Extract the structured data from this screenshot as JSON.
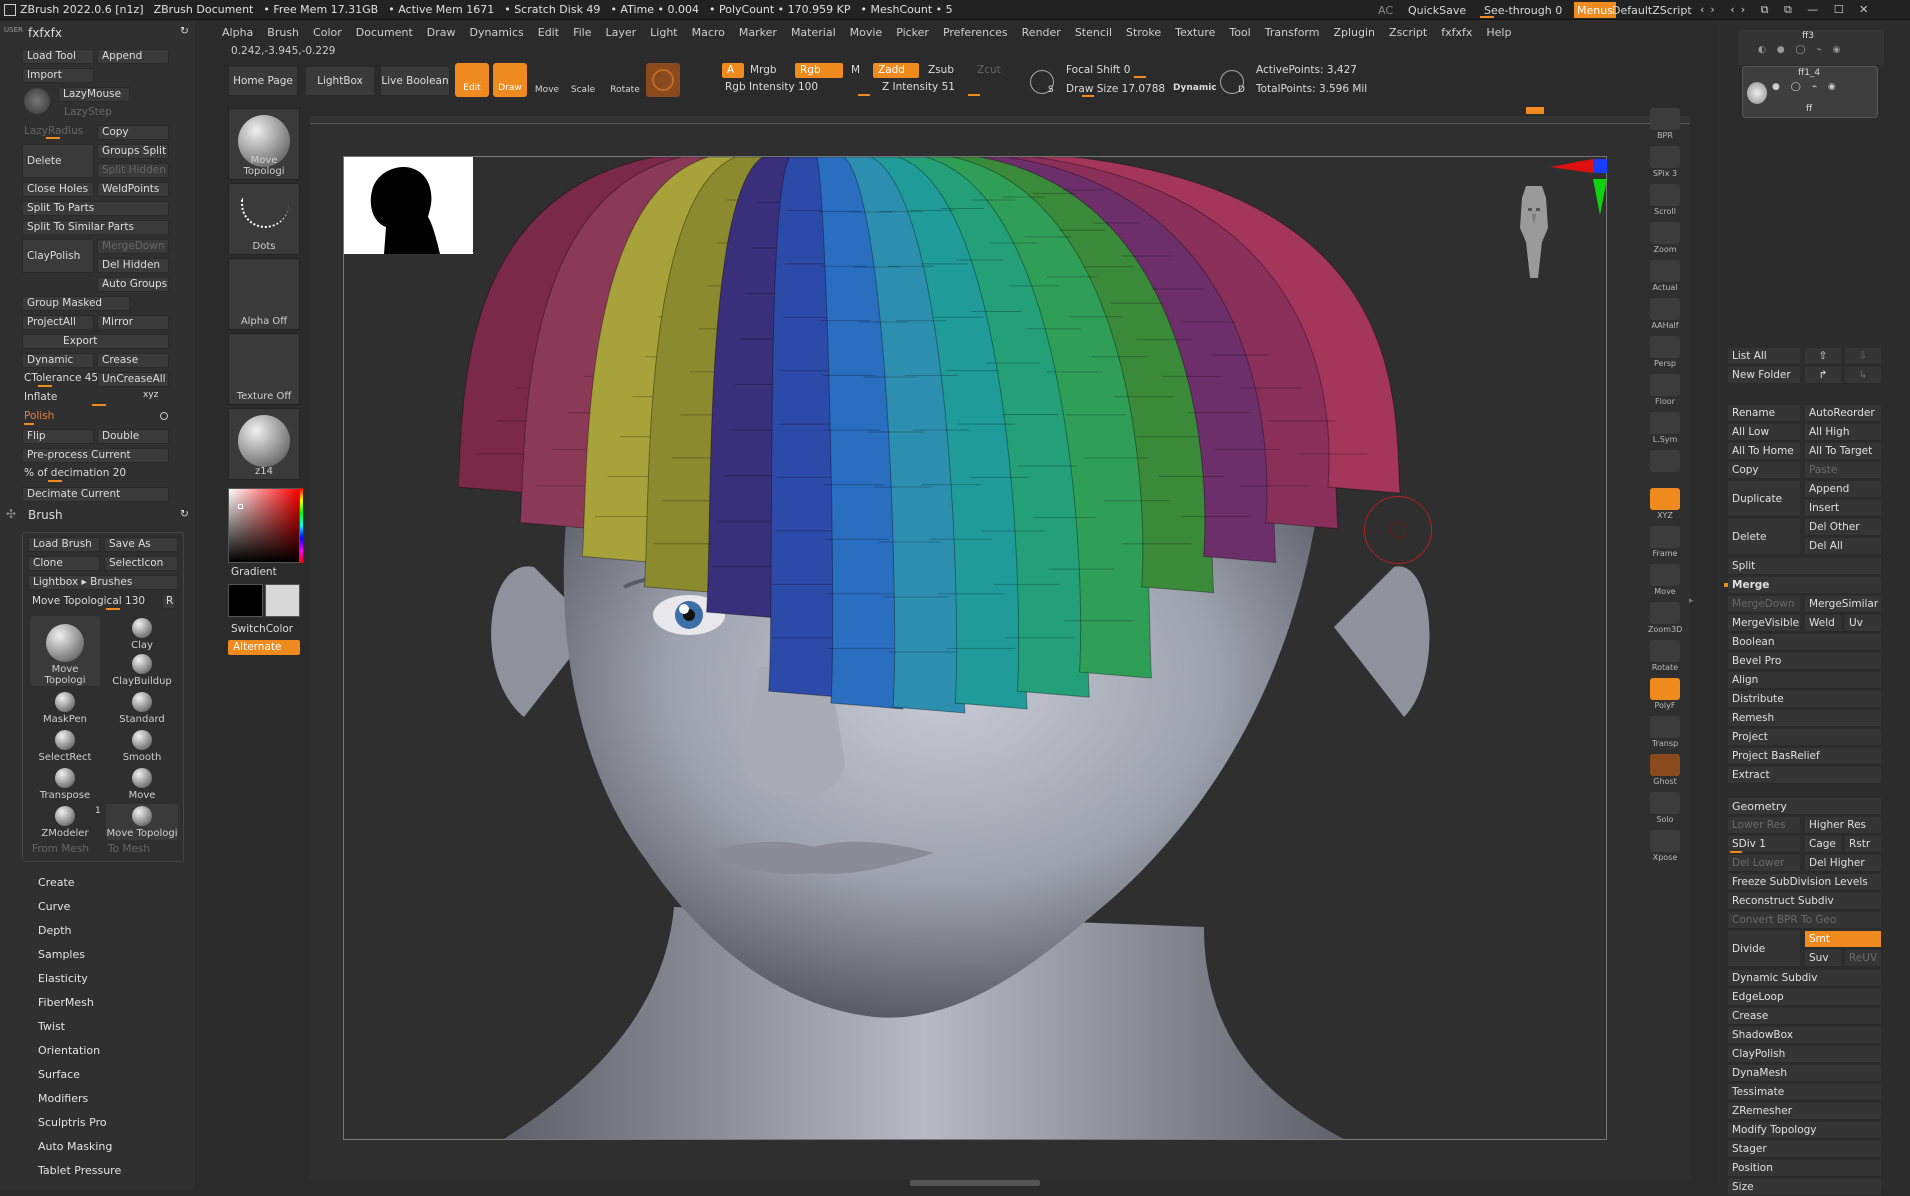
{
  "title_bar": {
    "app": "ZBrush 2022.0.6 [n1z]",
    "doc": "ZBrush Document",
    "free_mem": "• Free Mem 17.31GB",
    "active_mem": "• Active Mem 1671",
    "scratch": "• Scratch Disk 49",
    "atime": "• ATime • 0.004",
    "polycount": "• PolyCount • 170.959 KP",
    "meshcount": "• MeshCount • 5",
    "ac": "AC",
    "quicksave": "QuickSave",
    "see_through": "See-through  0",
    "menus": "Menus",
    "default_script": "DefaultZScript"
  },
  "menus": [
    "Alpha",
    "Brush",
    "Color",
    "Document",
    "Draw",
    "Dynamics",
    "Edit",
    "File",
    "Layer",
    "Light",
    "Macro",
    "Marker",
    "Material",
    "Movie",
    "Picker",
    "Preferences",
    "Render",
    "Stencil",
    "Stroke",
    "Texture",
    "Tool",
    "Transform",
    "Zplugin",
    "Zscript",
    "fxfxfx",
    "Help"
  ],
  "left_panel": {
    "user": "USER",
    "tool_name": "fxfxfx",
    "buttons": {
      "load_tool": "Load Tool",
      "append": "Append",
      "import": "Import",
      "lazymouse": "LazyMouse",
      "lazystep": "LazyStep",
      "lazyradius": "LazyRadius",
      "copy": "Copy",
      "delete": "Delete",
      "groups_split": "Groups Split",
      "split_hidden": "Split Hidden",
      "close_holes": "Close Holes",
      "weldpoints": "WeldPoints",
      "split_to_parts": "Split To Parts",
      "split_similar": "Split To Similar Parts",
      "claypolish": "ClayPolish",
      "mergedown": "MergeDown",
      "del_hidden": "Del Hidden",
      "auto_groups": "Auto Groups",
      "group_masked": "Group Masked",
      "projectall": "ProjectAll",
      "mirror": "Mirror",
      "export": "Export",
      "dynamic": "Dynamic",
      "crease": "Crease",
      "ctolerance": "CTolerance 45",
      "uncreaseall": "UnCreaseAll",
      "inflate": "Inflate",
      "xyz": "xyz",
      "polish": "Polish",
      "flip": "Flip",
      "double": "Double",
      "preprocess": "Pre-process Current",
      "decimation": "% of decimation 20",
      "decimate": "Decimate Current"
    }
  },
  "brush_panel": {
    "title": "Brush",
    "load_brush": "Load Brush",
    "save_as": "Save As",
    "clone": "Clone",
    "selecticon": "SelectIcon",
    "lightbox_brushes": "Lightbox ▸ Brushes",
    "move_topo_slider": "Move Topological  130",
    "r": "R",
    "brushes": [
      "Move Topologi",
      "Clay",
      "ClayBuildup",
      "MaskPen",
      "Standard",
      "SelectRect",
      "Smooth",
      "Transpose",
      "Move",
      "ZModeler",
      "Move Topologi"
    ],
    "zmodeler_count": "1",
    "from_mesh": "From Mesh",
    "to_mesh": "To Mesh"
  },
  "brush_sections": [
    "Create",
    "Curve",
    "Depth",
    "Samples",
    "Elasticity",
    "FiberMesh",
    "Twist",
    "Orientation",
    "Surface",
    "Modifiers",
    "Sculptris Pro",
    "Auto Masking",
    "Tablet Pressure"
  ],
  "shelf": {
    "coords": "0.242,-3.945,-0.229",
    "home_page": "Home Page",
    "lightbox": "LightBox",
    "live_boolean": "Live Boolean",
    "edit": "Edit",
    "draw": "Draw",
    "move": "Move",
    "scale": "Scale",
    "rotate": "Rotate",
    "a": "A",
    "mrgb": "Mrgb",
    "rgb": "Rgb",
    "m": "M",
    "rgb_intensity": "Rgb Intensity 100",
    "zadd": "Zadd",
    "zsub": "Zsub",
    "zcut": "Zcut",
    "z_intensity": "Z Intensity 51",
    "focal_shift": "Focal Shift 0",
    "draw_size": "Draw Size 17.0788",
    "dynamic": "Dynamic",
    "s": "S",
    "d": "D",
    "active_points": "ActivePoints: 3,427",
    "total_points": "TotalPoints: 3.596 Mil"
  },
  "left_shelf": {
    "thumbs": [
      "Move Topologi",
      "Dots",
      "Alpha Off",
      "Texture Off",
      "z14"
    ],
    "gradient": "Gradient",
    "switchcolor": "SwitchColor",
    "alternate": "Alternate"
  },
  "right_shelf": [
    {
      "icon": "bpr-icon",
      "label": "BPR"
    },
    {
      "icon": "spix-icon",
      "label": "SPix 3"
    },
    {
      "icon": "scroll-icon",
      "label": "Scroll"
    },
    {
      "icon": "zoom-icon",
      "label": "Zoom"
    },
    {
      "icon": "actual-icon",
      "label": "Actual"
    },
    {
      "icon": "aahalf-icon",
      "label": "AAHalf"
    },
    {
      "icon": "persp-icon",
      "label": "Persp"
    },
    {
      "icon": "floor-icon",
      "label": "Floor"
    },
    {
      "icon": "lsym-icon",
      "label": "L.Sym"
    },
    {
      "icon": "lock-icon",
      "label": ""
    },
    {
      "icon": "xyz-icon",
      "label": "XYZ"
    },
    {
      "icon": "frame-icon",
      "label": "Frame"
    },
    {
      "icon": "move-icon",
      "label": "Move"
    },
    {
      "icon": "zoom3d-icon",
      "label": "Zoom3D"
    },
    {
      "icon": "rotate-icon",
      "label": "Rotate"
    },
    {
      "icon": "polyf-icon",
      "label": "PolyF"
    },
    {
      "icon": "transp-icon",
      "label": "Transp"
    },
    {
      "icon": "ghost-icon",
      "label": "Ghost"
    },
    {
      "icon": "solo-icon",
      "label": "Solo"
    },
    {
      "icon": "xpose-icon",
      "label": "Xpose"
    }
  ],
  "subtool": {
    "items": [
      "ff3",
      "ff1_4",
      "ff"
    ],
    "list_all": "List All",
    "new_folder": "New Folder",
    "rename": "Rename",
    "autoreorder": "AutoReorder",
    "all_low": "All Low",
    "all_high": "All High",
    "all_to_home": "All To Home",
    "all_to_target": "All To Target",
    "copy": "Copy",
    "paste": "Paste",
    "duplicate": "Duplicate",
    "append": "Append",
    "insert": "Insert",
    "delete": "Delete",
    "del_other": "Del Other",
    "del_all": "Del All",
    "split": "Split",
    "merge": "Merge",
    "mergedown": "MergeDown",
    "mergesimilar": "MergeSimilar",
    "mergevisible": "MergeVisible",
    "weld": "Weld",
    "uv": "Uv",
    "sections": [
      "Boolean",
      "Bevel Pro",
      "Align",
      "Distribute",
      "Remesh",
      "Project",
      "Project BasRelief",
      "Extract"
    ]
  },
  "geometry": {
    "title": "Geometry",
    "lower_res": "Lower Res",
    "higher_res": "Higher Res",
    "sdiv": "SDiv 1",
    "cage": "Cage",
    "rstr": "Rstr",
    "del_lower": "Del Lower",
    "del_higher": "Del Higher",
    "freeze": "Freeze SubDivision Levels",
    "reconstruct": "Reconstruct Subdiv",
    "convert_bpr": "Convert BPR To Geo",
    "divide": "Divide",
    "smt": "Smt",
    "suv": "Suv",
    "reuv": "ReUV",
    "sections": [
      "Dynamic Subdiv",
      "EdgeLoop",
      "Crease",
      "ShadowBox",
      "ClayPolish",
      "DynaMesh",
      "Tessimate",
      "ZRemesher",
      "Modify Topology",
      "Stager",
      "Position",
      "Size"
    ]
  },
  "colors": {
    "accent": "#ef8a1f",
    "panel": "#353535",
    "bg": "#2b2b2b"
  },
  "hair_strips": [
    "#7a2a46",
    "#8a3a56",
    "#a8a23a",
    "#8b8a2e",
    "#3a2f7a",
    "#2c4aa8",
    "#2a6ec0",
    "#2d8fb0",
    "#1f9c9a",
    "#24a079",
    "#2f9f58",
    "#3a8a3a",
    "#6c2f6a",
    "#8a2f5a",
    "#a3365a"
  ]
}
